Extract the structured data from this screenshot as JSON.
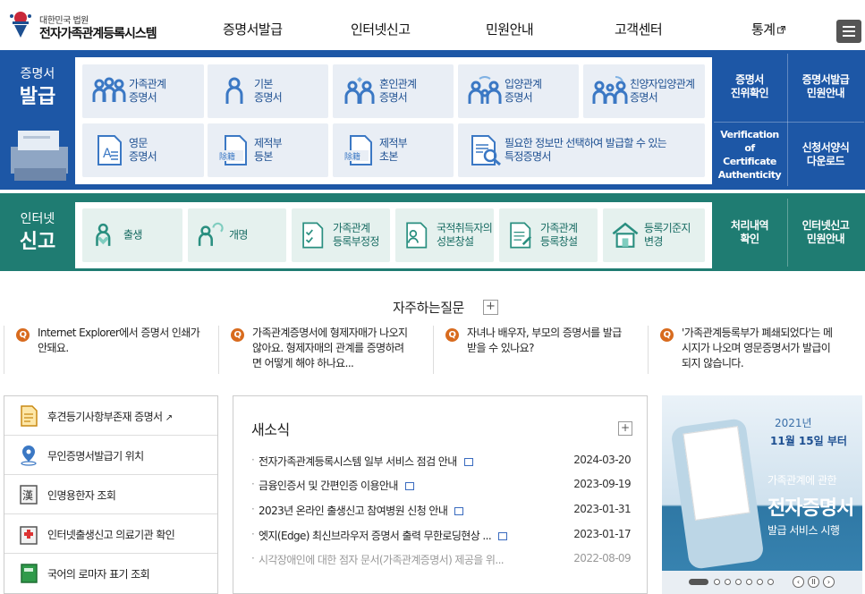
{
  "header": {
    "logo_sub": "대한민국 법원",
    "logo_main": "전자가족관계등록시스템",
    "nav": [
      "증명서발급",
      "인터넷신고",
      "민원안내",
      "고객센터",
      "통계"
    ],
    "menu_icon": "hamburger-icon"
  },
  "issue": {
    "cap_top": "증명서",
    "cap_bottom": "발급",
    "cards": [
      {
        "l1": "가족관계",
        "l2": "증명서",
        "icon": "family-icon"
      },
      {
        "l1": "기본",
        "l2": "증명서",
        "icon": "person-icon"
      },
      {
        "l1": "혼인관계",
        "l2": "증명서",
        "icon": "marriage-icon"
      },
      {
        "l1": "입양관계",
        "l2": "증명서",
        "icon": "adoption-icon"
      },
      {
        "l1": "친양자입양관계",
        "l2": "증명서",
        "icon": "full-adoption-icon"
      },
      {
        "l1": "영문",
        "l2": "증명서",
        "icon": "english-doc-icon"
      },
      {
        "l1": "제적부",
        "l2": "등본",
        "icon": "register-copy-icon"
      },
      {
        "l1": "제적부",
        "l2": "초본",
        "icon": "register-abstract-icon"
      },
      {
        "l1": "필요한 정보만 선택하여 발급할 수 있는",
        "l2": "특정증명서",
        "icon": "search-doc-icon"
      }
    ],
    "quick": [
      {
        "l1": "증명서",
        "l2": "진위확인"
      },
      {
        "l1": "증명서발급",
        "l2": "민원안내"
      },
      {
        "l1": "Verification of",
        "l2": "Certificate",
        "l3": "Authenticity"
      },
      {
        "l1": "신청서양식",
        "l2": "다운로드"
      }
    ]
  },
  "report": {
    "cap_top": "인터넷",
    "cap_bottom": "신고",
    "cards": [
      {
        "l1": "출생",
        "l2": "",
        "icon": "birth-icon"
      },
      {
        "l1": "개명",
        "l2": "",
        "icon": "rename-icon"
      },
      {
        "l1": "가족관계",
        "l2": "등록부정정",
        "icon": "correction-icon"
      },
      {
        "l1": "국적취득자의",
        "l2": "성본창설",
        "icon": "nationality-icon"
      },
      {
        "l1": "가족관계",
        "l2": "등록창설",
        "icon": "registration-icon"
      },
      {
        "l1": "등록기준지",
        "l2": "변경",
        "icon": "home-icon"
      }
    ],
    "quick": [
      {
        "l1": "처리내역",
        "l2": "확인"
      },
      {
        "l1": "인터넷신고",
        "l2": "민원안내"
      }
    ]
  },
  "faq": {
    "title": "자주하는질문",
    "plus": "+",
    "q_badge": "Q",
    "items": [
      {
        "a": "Internet Explorer에서 증명서 인쇄가",
        "b": "안돼요.",
        "c": ""
      },
      {
        "a": "가족관계증명서에 형제자매가 나오지",
        "b": "않아요. 형제자매의 관계를 증명하려",
        "c": "면 어떻게 해야 하나요..."
      },
      {
        "a": "자녀나 배우자, 부모의 증명서를 발급",
        "b": "받을 수 있나요?",
        "c": ""
      },
      {
        "a": "'가족관계등록부가 폐쇄되었다'는 메",
        "b": "시지가 나오며 영문증명서가 발급이",
        "c": "되지 않습니다."
      }
    ]
  },
  "links": [
    {
      "label": "후견등기사항부존재 증명서",
      "icon": "document-icon",
      "external": "↗"
    },
    {
      "label": "무인증명서발급기 위치",
      "icon": "location-pin-icon",
      "external": ""
    },
    {
      "label": "인명용한자 조회",
      "icon": "hanja-book-icon",
      "external": ""
    },
    {
      "label": "인터넷출생신고 의료기관 확인",
      "icon": "hospital-icon",
      "external": ""
    },
    {
      "label": "국어의 로마자 표기 조회",
      "icon": "green-book-icon",
      "external": ""
    }
  ],
  "news": {
    "title": "새소식",
    "plus": "+",
    "items": [
      {
        "title": "전자가족관계등록시스템 일부 서비스 점검 안내",
        "date": "2024-03-20"
      },
      {
        "title": "금융인증서 및 간편인증 이용안내",
        "date": "2023-09-19"
      },
      {
        "title": "2023년 온라인 출생신고 참여병원 신청 안내",
        "date": "2023-01-31"
      },
      {
        "title": "엣지(Edge) 최신브라우저 증명서 출력 무한로딩현상 ...",
        "date": "2023-01-17"
      },
      {
        "title": "시각장애인에 대한 점자 문서(가족관계증명서) 제공을 위...",
        "date": "2022-08-09"
      }
    ]
  },
  "banner": {
    "year": "2021년",
    "date": "11월 15일 부터",
    "line1": "가족관계에 관한",
    "line2": "전자증명서",
    "line3": "발급 서비스 시행",
    "prev": "‹",
    "pause": "II",
    "next": "›"
  },
  "colors": {
    "issue_band": "#1d57a6",
    "report_band": "#1f7c72",
    "faq_badge": "#d86b1e"
  }
}
